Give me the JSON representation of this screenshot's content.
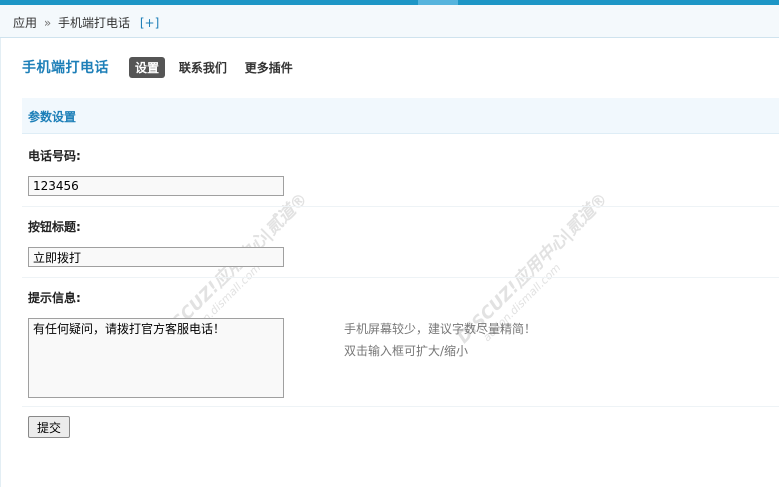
{
  "breadcrumb": {
    "root": "应用",
    "separator": "»",
    "current": "手机端打电话",
    "add": "[+]"
  },
  "header": {
    "plugin_title": "手机端打电话",
    "tabs": [
      {
        "label": "设置",
        "active": true
      },
      {
        "label": "联系我们",
        "active": false
      },
      {
        "label": "更多插件",
        "active": false
      }
    ]
  },
  "section": {
    "title": "参数设置"
  },
  "form": {
    "phone": {
      "label": "电话号码:",
      "value": "123456"
    },
    "button_title": {
      "label": "按钮标题:",
      "value": "立即拨打"
    },
    "tip_info": {
      "label": "提示信息:",
      "value": "有任何疑问，请拨打官方客服电话！",
      "help_line1": "手机屏幕较少，建议字数尽量精简！",
      "help_line2": "双击输入框可扩大/缩小"
    },
    "submit_label": "提交"
  },
  "watermark": {
    "brand": "DISCUZ!应用中心",
    "url": "addon.dismall.com",
    "tag": "|贰道®"
  },
  "colors": {
    "accent": "#1d96c6",
    "link": "#1d7fb8",
    "section_bg": "#f1f8fd",
    "active_tab": "#555555"
  }
}
